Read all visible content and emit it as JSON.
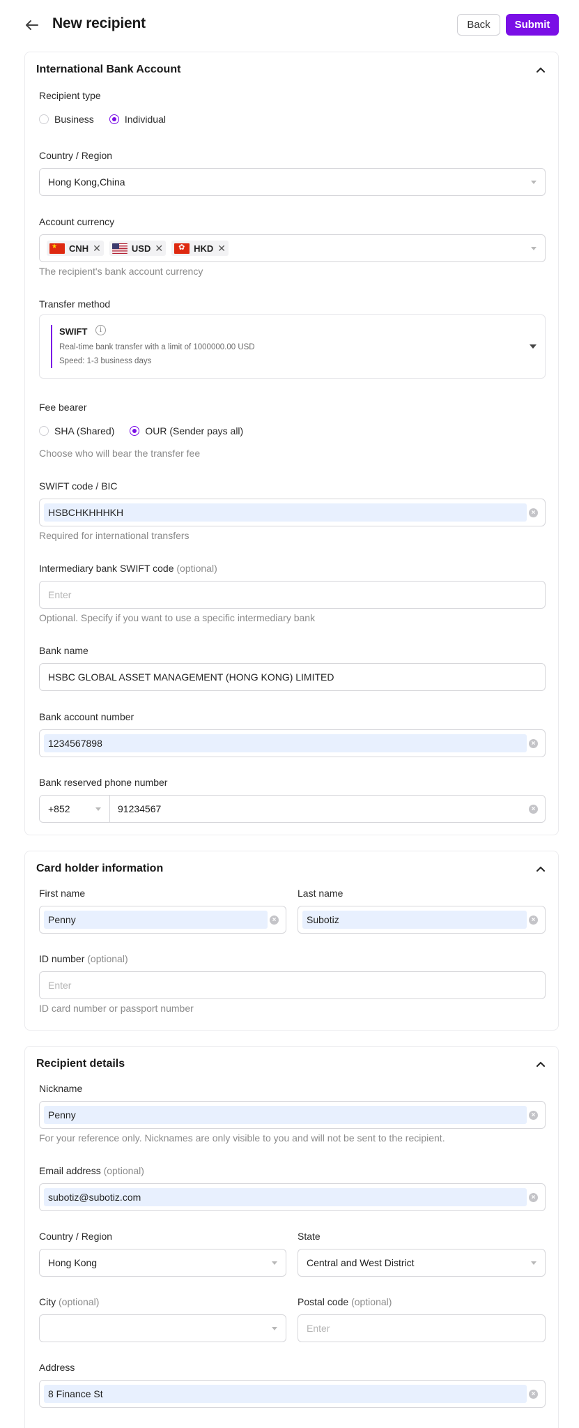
{
  "header": {
    "title": "New recipient",
    "back_label": "Back",
    "submit_label": "Submit"
  },
  "bank_account": {
    "title": "International Bank Account",
    "recipient_type": {
      "label": "Recipient type",
      "options": [
        "Business",
        "Individual"
      ],
      "selected": "Individual"
    },
    "country": {
      "label": "Country / Region",
      "value": "Hong Kong,China"
    },
    "currency": {
      "label": "Account currency",
      "tags": [
        "CNH",
        "USD",
        "HKD"
      ],
      "hint": "The recipient's bank account currency"
    },
    "transfer_method": {
      "label": "Transfer method",
      "name": "SWIFT",
      "description": "Real-time bank transfer with a limit of 1000000.00 USD",
      "speed": "Speed: 1-3 business days"
    },
    "fee_bearer": {
      "label": "Fee bearer",
      "options": [
        "SHA (Shared)",
        "OUR (Sender pays all)"
      ],
      "selected": "OUR (Sender pays all)",
      "hint": "Choose who will bear the transfer fee"
    },
    "swift": {
      "label": "SWIFT code / BIC",
      "value": "HSBCHKHHHKH",
      "hint": "Required for international transfers"
    },
    "intermediary": {
      "label": "Intermediary bank SWIFT code",
      "optional": "(optional)",
      "placeholder": "Enter",
      "hint": "Optional. Specify if you want to use a specific intermediary bank"
    },
    "bank_name": {
      "label": "Bank name",
      "value": "HSBC GLOBAL ASSET MANAGEMENT (HONG KONG) LIMITED"
    },
    "account_number": {
      "label": "Bank account number",
      "value": "1234567898"
    },
    "phone": {
      "label": "Bank reserved phone number",
      "prefix": "+852",
      "value": "91234567"
    }
  },
  "card_holder": {
    "title": "Card holder information",
    "first_name": {
      "label": "First name",
      "value": "Penny"
    },
    "last_name": {
      "label": "Last name",
      "value": "Subotiz"
    },
    "id_number": {
      "label": "ID number",
      "optional": "(optional)",
      "placeholder": "Enter",
      "hint": "ID card number or passport number"
    }
  },
  "recipient": {
    "title": "Recipient details",
    "nickname": {
      "label": "Nickname",
      "value": "Penny",
      "hint": "For your reference only. Nicknames are only visible to you and will not be sent to the recipient."
    },
    "email": {
      "label": "Email address",
      "optional": "(optional)",
      "value": "subotiz@subotiz.com"
    },
    "country": {
      "label": "Country / Region",
      "value": "Hong Kong"
    },
    "state": {
      "label": "State",
      "value": "Central and West District"
    },
    "city": {
      "label": "City",
      "optional": "(optional)"
    },
    "postal": {
      "label": "Postal code",
      "optional": "(optional)",
      "placeholder": "Enter"
    },
    "address": {
      "label": "Address",
      "value": "8 Finance St"
    }
  },
  "colors": {
    "accent": "#7a0fe6",
    "autofill": "#e8f0fe"
  }
}
